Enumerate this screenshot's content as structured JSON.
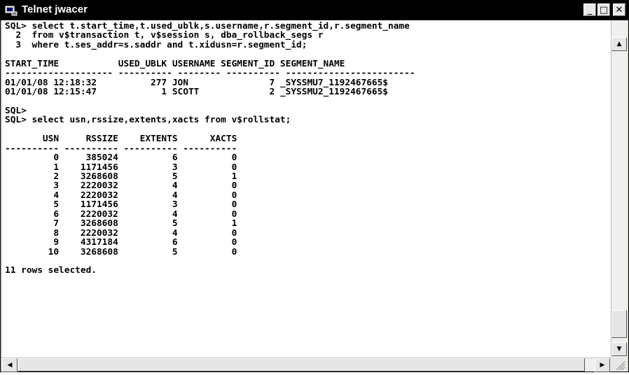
{
  "window": {
    "title": "Telnet jwacer",
    "minimize_glyph": "_",
    "maximize_glyph": "□",
    "close_glyph": "✕"
  },
  "terminal": {
    "lines": [
      "SQL> select t.start_time,t.used_ublk,s.username,r.segment_id,r.segment_name",
      "  2  from v$transaction t, v$session s, dba_rollback_segs r",
      "  3  where t.ses_addr=s.saddr and t.xidusn=r.segment_id;",
      "",
      "START_TIME           USED_UBLK USERNAME SEGMENT_ID SEGMENT_NAME",
      "-------------------- ---------- -------- ---------- ------------------------",
      "01/01/08 12:18:32          277 JON               7 _SYSSMU7_1192467665$",
      "01/01/08 12:15:47            1 SCOTT             2 _SYSSMU2_1192467665$",
      "",
      "SQL>",
      "SQL> select usn,rssize,extents,xacts from v$rollstat;",
      "",
      "       USN     RSSIZE    EXTENTS      XACTS",
      "---------- ---------- ---------- ----------",
      "         0     385024          6          0",
      "         1    1171456          3          0",
      "         2    3268608          5          1",
      "         3    2220032          4          0",
      "         4    2220032          4          0",
      "         5    1171456          3          0",
      "         6    2220032          4          0",
      "         7    3268608          5          1",
      "         8    2220032          4          0",
      "         9    4317184          6          0",
      "        10    3268608          5          0",
      "",
      "11 rows selected."
    ]
  },
  "scrollbars": {
    "up_arrow": "▲",
    "down_arrow": "▼",
    "left_arrow": "◀",
    "right_arrow": "▶"
  }
}
